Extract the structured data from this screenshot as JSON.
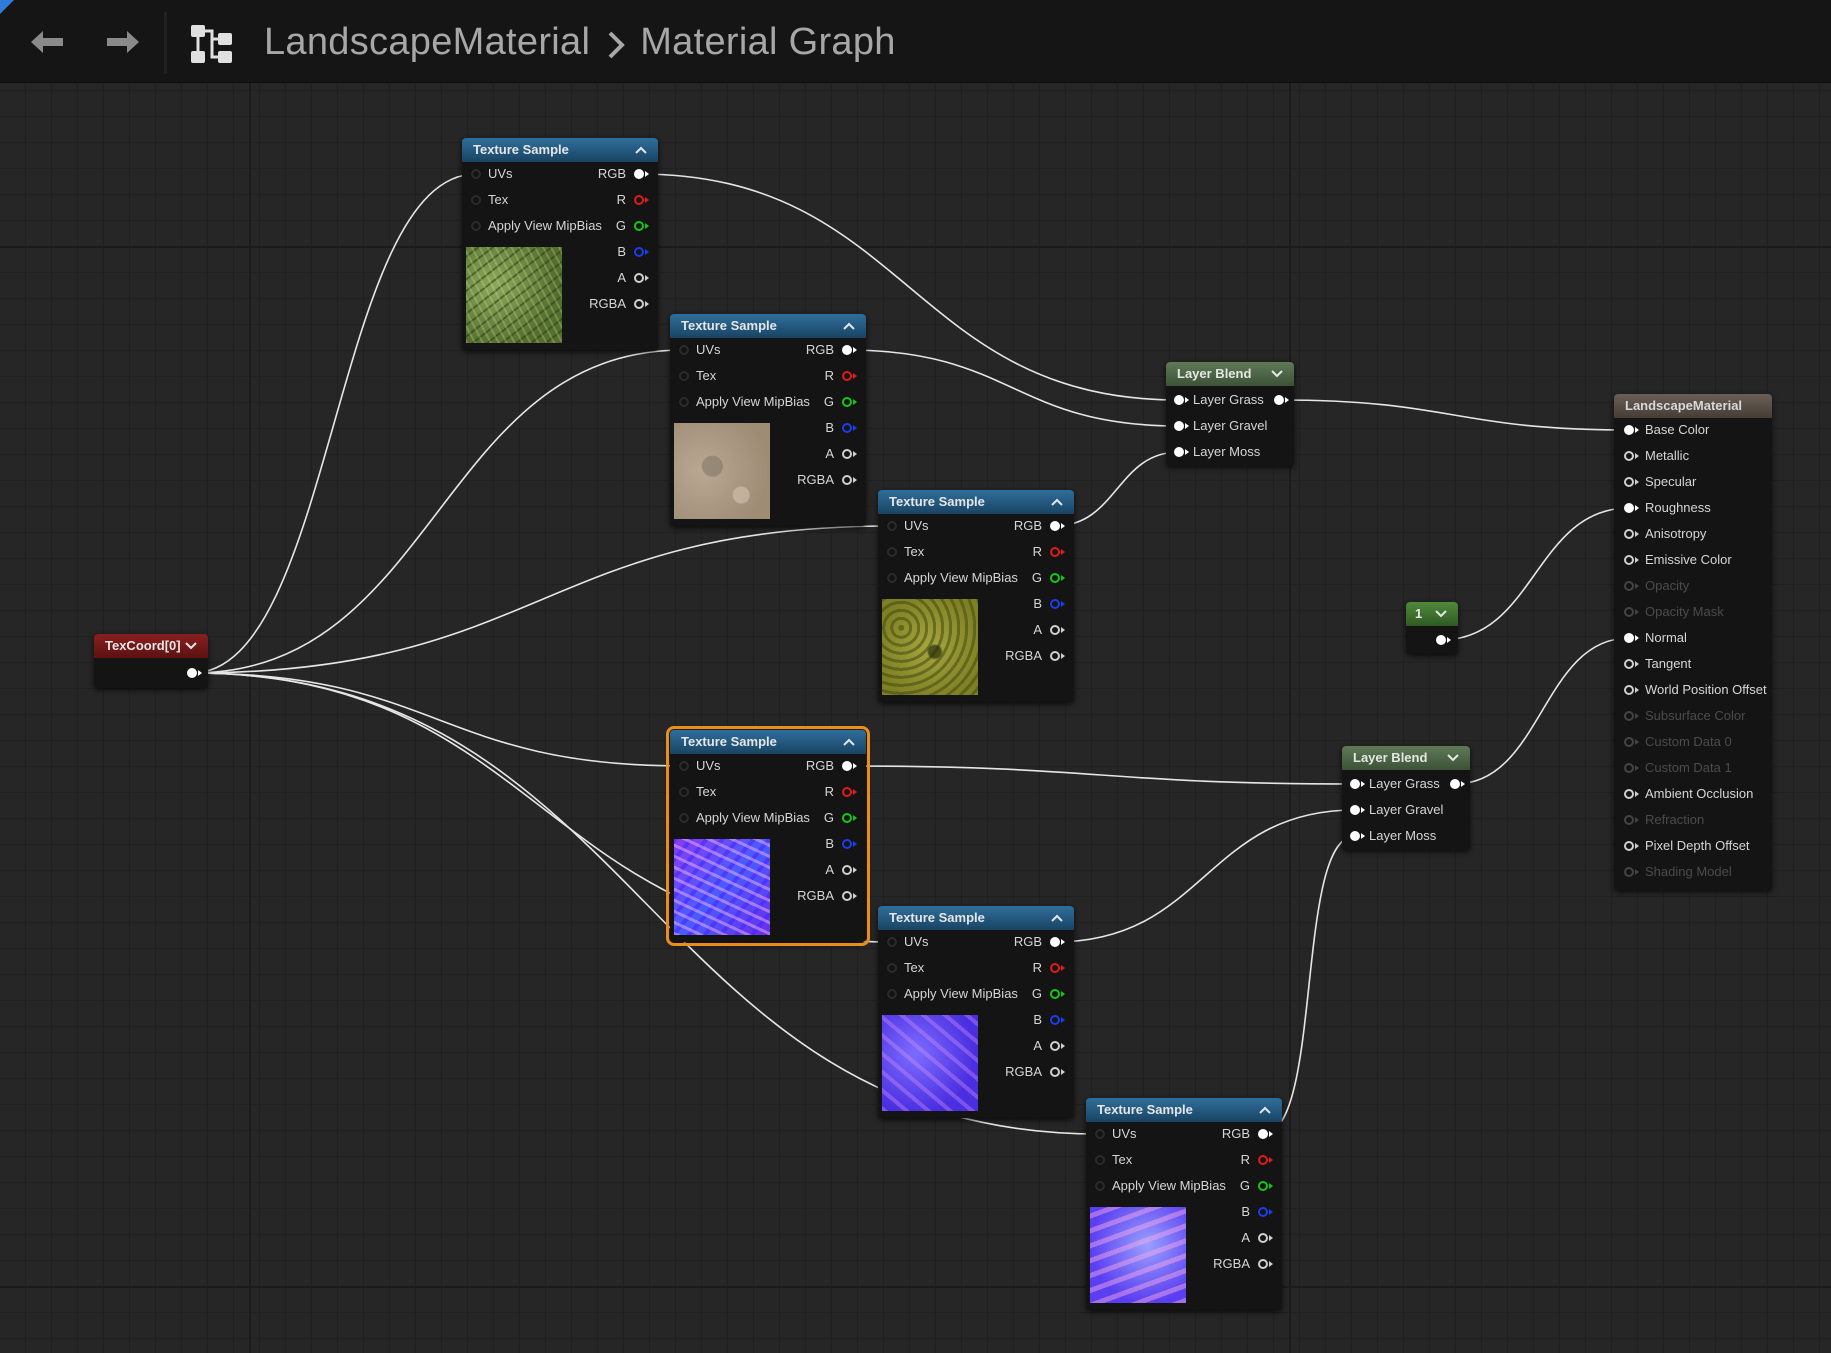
{
  "header": {
    "back_label": "back",
    "forward_label": "forward",
    "breadcrumb": [
      "LandscapeMaterial",
      "Material Graph"
    ]
  },
  "nodes": {
    "texcoord": {
      "title": "TexCoord[0]"
    },
    "constant": {
      "title": "1"
    },
    "texture_samples": [
      {
        "title": "Texture Sample",
        "preview": "grass"
      },
      {
        "title": "Texture Sample",
        "preview": "gravel"
      },
      {
        "title": "Texture Sample",
        "preview": "moss"
      },
      {
        "title": "Texture Sample",
        "preview": "grass-normal",
        "selected": true
      },
      {
        "title": "Texture Sample",
        "preview": "gravel-normal"
      },
      {
        "title": "Texture Sample",
        "preview": "moss-normal"
      }
    ],
    "texture_sample_pins": {
      "inputs": [
        "UVs",
        "Tex",
        "Apply View MipBias"
      ],
      "outputs": [
        "RGB",
        "R",
        "G",
        "B",
        "A",
        "RGBA"
      ]
    },
    "layer_blends": [
      {
        "title": "Layer Blend",
        "layers": [
          "Layer Grass",
          "Layer Gravel",
          "Layer Moss"
        ]
      },
      {
        "title": "Layer Blend",
        "layers": [
          "Layer Grass",
          "Layer Gravel",
          "Layer Moss"
        ]
      }
    ],
    "result": {
      "title": "LandscapeMaterial",
      "inputs": [
        {
          "label": "Base Color",
          "enabled": true,
          "connected": true
        },
        {
          "label": "Metallic",
          "enabled": true
        },
        {
          "label": "Specular",
          "enabled": true
        },
        {
          "label": "Roughness",
          "enabled": true,
          "connected": true
        },
        {
          "label": "Anisotropy",
          "enabled": true
        },
        {
          "label": "Emissive Color",
          "enabled": true
        },
        {
          "label": "Opacity",
          "enabled": false
        },
        {
          "label": "Opacity Mask",
          "enabled": false
        },
        {
          "label": "Normal",
          "enabled": true,
          "connected": true
        },
        {
          "label": "Tangent",
          "enabled": true
        },
        {
          "label": "World Position Offset",
          "enabled": true
        },
        {
          "label": "Subsurface Color",
          "enabled": false
        },
        {
          "label": "Custom Data 0",
          "enabled": false
        },
        {
          "label": "Custom Data 1",
          "enabled": false
        },
        {
          "label": "Ambient Occlusion",
          "enabled": true
        },
        {
          "label": "Refraction",
          "enabled": false
        },
        {
          "label": "Pixel Depth Offset",
          "enabled": true
        },
        {
          "label": "Shading Model",
          "enabled": false
        }
      ]
    }
  },
  "colors": {
    "selection": "#e98d1c",
    "wire": "#e6e6e6",
    "pin_r": "#e51919",
    "pin_g": "#16c716",
    "pin_b": "#1a3fe8",
    "texture_header": "#2f6e9c",
    "blend_header": "#5f7a58",
    "texcoord_header": "#8a1f1f",
    "constant_header": "#4f8a3c",
    "result_header": "#6a5f57"
  }
}
